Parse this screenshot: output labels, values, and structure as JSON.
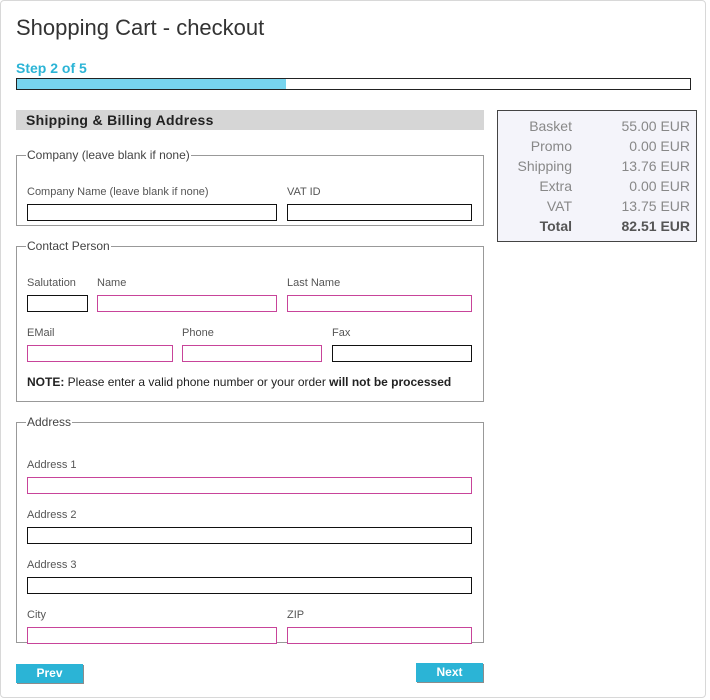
{
  "page": {
    "title": "Shopping Cart - checkout",
    "step_label": "Step 2 of 5",
    "progress_fraction": 0.4
  },
  "form": {
    "section_title": "Shipping & Billing Address",
    "company": {
      "legend": "Company (leave blank if none)",
      "company_name_label": "Company Name (leave blank if none)",
      "vat_id_label": "VAT ID"
    },
    "contact": {
      "legend": "Contact Person",
      "salutation_label": "Salutation",
      "name_label": "Name",
      "last_name_label": "Last Name",
      "email_label": "EMail",
      "phone_label": "Phone",
      "fax_label": "Fax",
      "note_prefix": "NOTE:",
      "note_text": " Please enter a valid phone number or your order ",
      "note_emphasis": "will not be processed"
    },
    "address": {
      "legend": "Address",
      "address1_label": "Address 1",
      "address2_label": "Address 2",
      "address3_label": "Address 3",
      "city_label": "City",
      "zip_label": "ZIP"
    }
  },
  "summary": {
    "rows": [
      {
        "label": "Basket",
        "value": "55.00 EUR"
      },
      {
        "label": "Promo",
        "value": "0.00 EUR"
      },
      {
        "label": "Shipping",
        "value": "13.76 EUR"
      },
      {
        "label": "Extra",
        "value": "0.00 EUR"
      },
      {
        "label": "VAT",
        "value": "13.75 EUR"
      }
    ],
    "total": {
      "label": "Total",
      "value": "82.51 EUR"
    }
  },
  "nav": {
    "prev_label": "Prev",
    "next_label": "Next"
  },
  "colors": {
    "accent": "#2bb4d6",
    "progress": "#77d4ee",
    "required_border": "#c8449a"
  }
}
